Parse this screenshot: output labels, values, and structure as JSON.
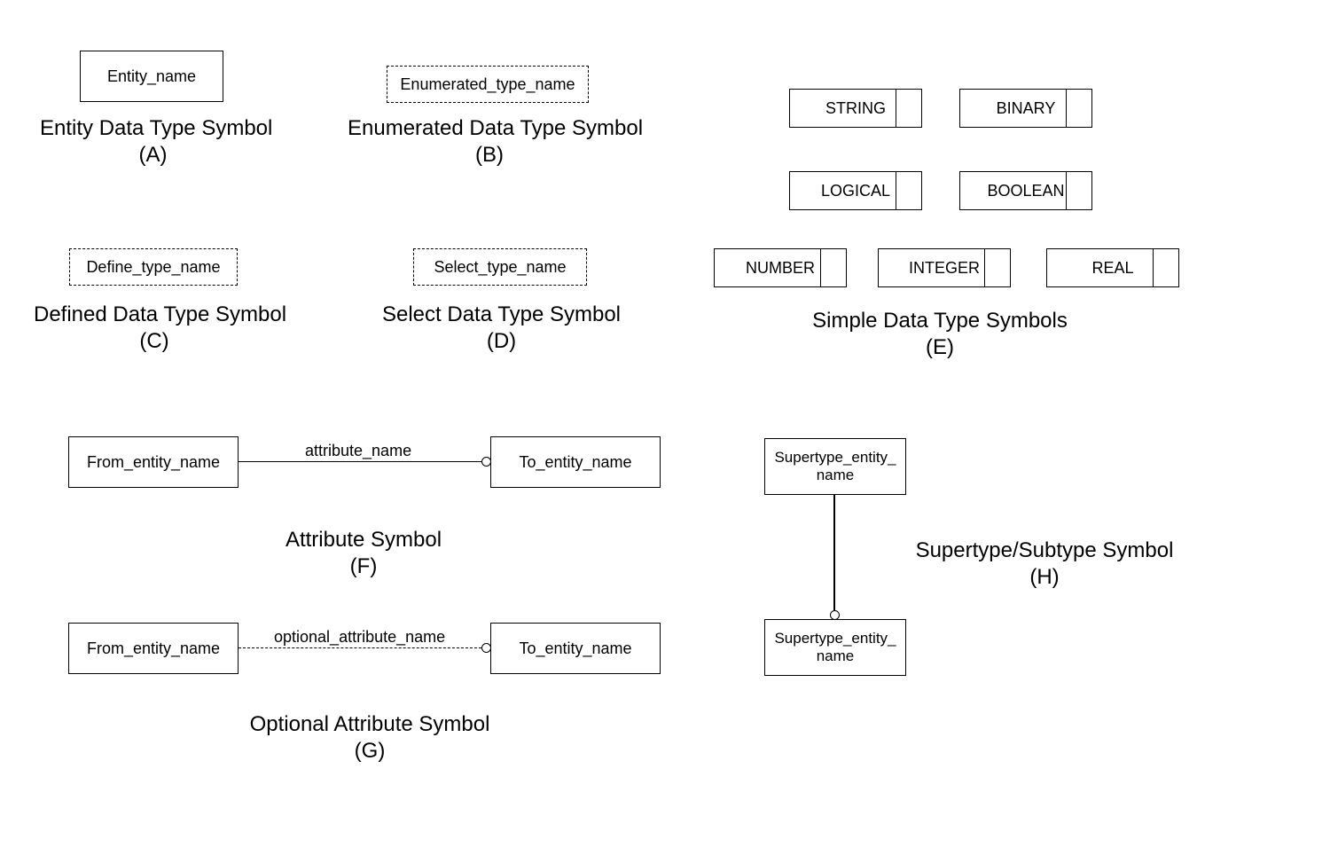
{
  "A": {
    "box_label": "Entity_name",
    "caption_line1": "Entity Data Type Symbol",
    "caption_line2": "(A)"
  },
  "B": {
    "box_label": "Enumerated_type_name",
    "caption_line1": "Enumerated Data Type Symbol",
    "caption_line2": "(B)"
  },
  "C": {
    "box_label": "Define_type_name",
    "caption_line1": "Defined Data Type Symbol",
    "caption_line2": "(C)"
  },
  "D": {
    "box_label": "Select_type_name",
    "caption_line1": "Select Data Type Symbol",
    "caption_line2": "(D)"
  },
  "E": {
    "types": {
      "string": "STRING",
      "binary": "BINARY",
      "logical": "LOGICAL",
      "boolean": "BOOLEAN",
      "number": "NUMBER",
      "integer": "INTEGER",
      "real": "REAL"
    },
    "caption_line1": "Simple Data Type Symbols",
    "caption_line2": "(E)"
  },
  "F": {
    "from_label": "From_entity_name",
    "to_label": "To_entity_name",
    "edge_label": "attribute_name",
    "caption_line1": "Attribute Symbol",
    "caption_line2": "(F)"
  },
  "G": {
    "from_label": "From_entity_name",
    "to_label": "To_entity_name",
    "edge_label": "optional_attribute_name",
    "caption_line1": "Optional Attribute Symbol",
    "caption_line2": "(G)"
  },
  "H": {
    "super_label": "Supertype_entity_\nname",
    "sub_label": "Supertype_entity_\nname",
    "caption_line1": "Supertype/Subtype Symbol",
    "caption_line2": "(H)"
  }
}
